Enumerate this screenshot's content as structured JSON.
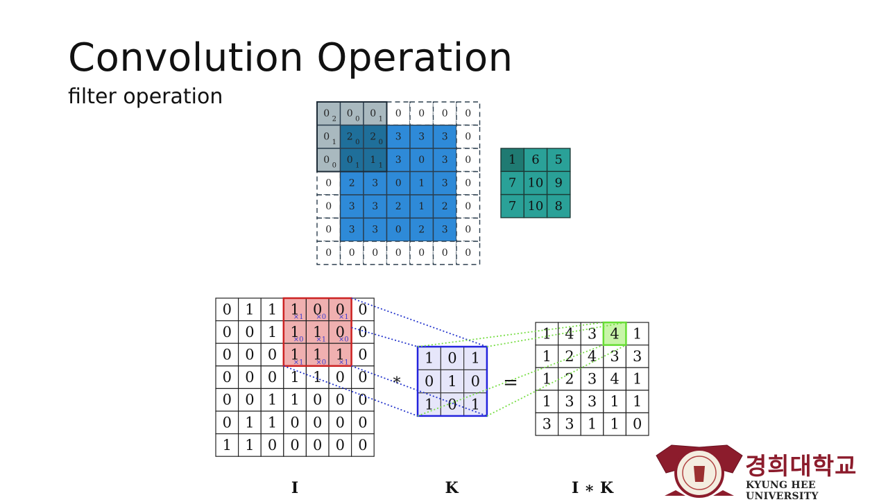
{
  "slide": {
    "title": "Convolution Operation",
    "subtitle": "filter operation"
  },
  "padded_example": {
    "grid": [
      [
        "0",
        "0",
        "0",
        "0",
        "0",
        "0",
        "0"
      ],
      [
        "0",
        "2",
        "2",
        "3",
        "3",
        "3",
        "0"
      ],
      [
        "0",
        "0",
        "1",
        "3",
        "0",
        "3",
        "0"
      ],
      [
        "0",
        "2",
        "3",
        "0",
        "1",
        "3",
        "0"
      ],
      [
        "0",
        "3",
        "3",
        "2",
        "1",
        "2",
        "0"
      ],
      [
        "0",
        "3",
        "3",
        "0",
        "2",
        "3",
        "0"
      ],
      [
        "0",
        "0",
        "0",
        "0",
        "0",
        "0",
        "0"
      ]
    ],
    "kernel_subscripts": [
      [
        "2",
        "0",
        "1"
      ],
      [
        "1",
        "0",
        "0"
      ],
      [
        "0",
        "1",
        "1"
      ]
    ],
    "output": [
      [
        "1",
        "6",
        "5"
      ],
      [
        "7",
        "10",
        "9"
      ],
      [
        "7",
        "10",
        "8"
      ]
    ]
  },
  "conv_example": {
    "I": [
      [
        "0",
        "1",
        "1",
        "1",
        "0",
        "0",
        "0"
      ],
      [
        "0",
        "0",
        "1",
        "1",
        "1",
        "0",
        "0"
      ],
      [
        "0",
        "0",
        "0",
        "1",
        "1",
        "1",
        "0"
      ],
      [
        "0",
        "0",
        "0",
        "1",
        "1",
        "0",
        "0"
      ],
      [
        "0",
        "0",
        "1",
        "1",
        "0",
        "0",
        "0"
      ],
      [
        "0",
        "1",
        "1",
        "0",
        "0",
        "0",
        "0"
      ],
      [
        "1",
        "1",
        "0",
        "0",
        "0",
        "0",
        "0"
      ]
    ],
    "I_subscripts": [
      [
        "×1",
        "×0",
        "×1"
      ],
      [
        "×0",
        "×1",
        "×0"
      ],
      [
        "×1",
        "×0",
        "×1"
      ]
    ],
    "K": [
      [
        "1",
        "0",
        "1"
      ],
      [
        "0",
        "1",
        "0"
      ],
      [
        "1",
        "0",
        "1"
      ]
    ],
    "IK": [
      [
        "1",
        "4",
        "3",
        "4",
        "1"
      ],
      [
        "1",
        "2",
        "4",
        "3",
        "3"
      ],
      [
        "1",
        "2",
        "3",
        "4",
        "1"
      ],
      [
        "1",
        "3",
        "3",
        "1",
        "1"
      ],
      [
        "3",
        "3",
        "1",
        "1",
        "0"
      ]
    ],
    "operator_conv": "*",
    "operator_eq": "=",
    "label_I": "I",
    "label_K": "K",
    "label_IK": "I ∗ K"
  },
  "logo": {
    "korean": "경희대학교",
    "english": "KYUNG HEE UNIVERSITY"
  },
  "colors": {
    "blue_input": "#2e8ad8",
    "kernel_gray": "#a9b9bf",
    "output_teal": "#2aa198",
    "highlight_red": "#f0b0b0",
    "kernel_blue": "#e6e6fa",
    "result_green": "#c8f5a8",
    "logo_red": "#8c1c2c"
  }
}
